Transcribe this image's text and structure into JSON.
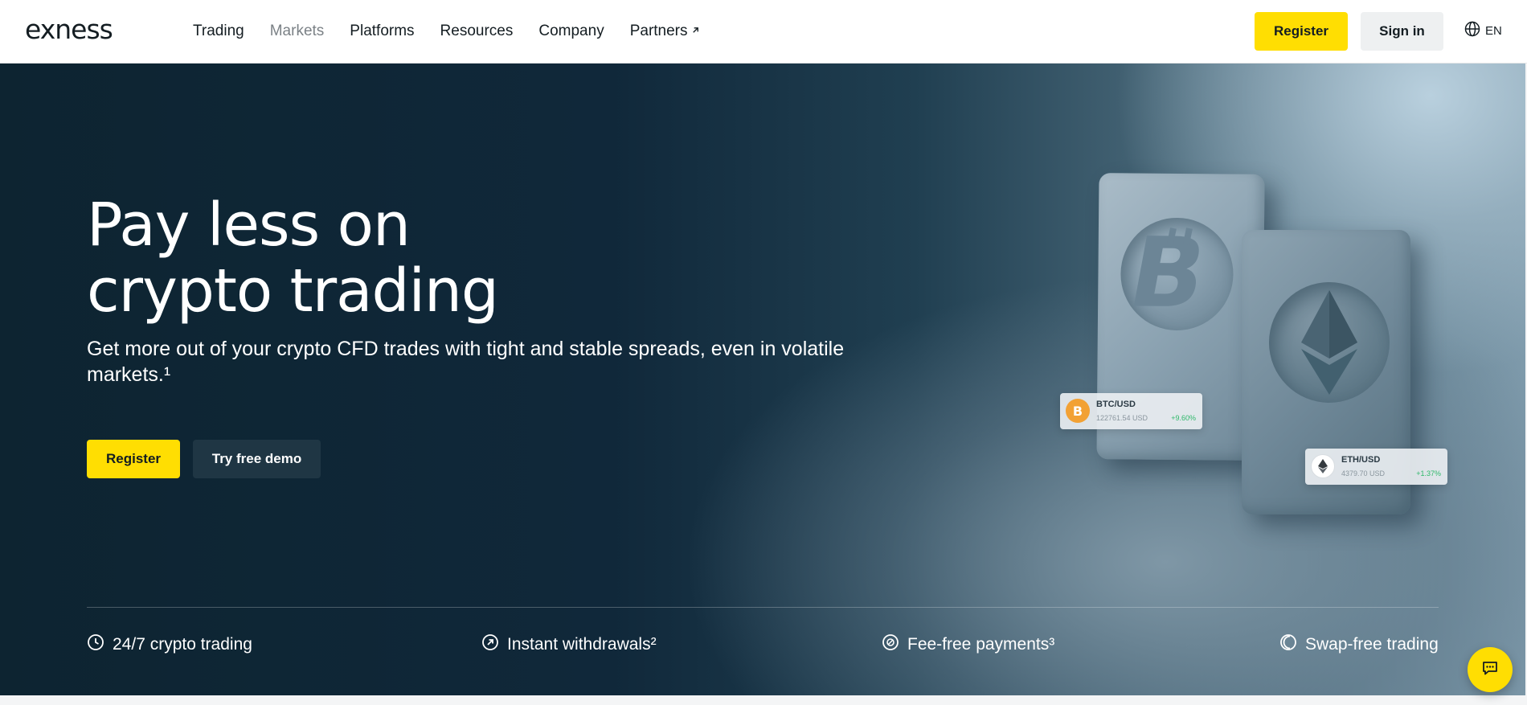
{
  "header": {
    "logo": "exness",
    "nav": [
      {
        "label": "Trading"
      },
      {
        "label": "Markets"
      },
      {
        "label": "Platforms"
      },
      {
        "label": "Resources"
      },
      {
        "label": "Company"
      },
      {
        "label": "Partners",
        "icon": "external-arrow-icon"
      }
    ],
    "register_label": "Register",
    "signin_label": "Sign in",
    "language": "EN"
  },
  "hero": {
    "title_line1": "Pay less on",
    "title_line2": "crypto trading",
    "subtitle": "Get more out of your crypto CFD trades with tight and stable spreads, even in volatile markets.¹",
    "register_label": "Register",
    "demo_label": "Try free demo"
  },
  "tickers": {
    "btc": {
      "pair": "BTC/USD",
      "price": "122761.54 USD",
      "change": "+9.60%"
    },
    "eth": {
      "pair": "ETH/USD",
      "price": "4379.70 USD",
      "change": "+1.37%"
    }
  },
  "features": [
    {
      "label": "24/7 crypto trading",
      "icon": "clock-icon"
    },
    {
      "label": "Instant withdrawals²",
      "icon": "arrow-circle-icon"
    },
    {
      "label": "Fee-free payments³",
      "icon": "coin-icon"
    },
    {
      "label": "Swap-free trading",
      "icon": "moon-icon"
    }
  ],
  "colors": {
    "accent": "#ffde02",
    "dark": "#141d22",
    "hero_bg": "#0d2431",
    "positive": "#2fb86a"
  }
}
